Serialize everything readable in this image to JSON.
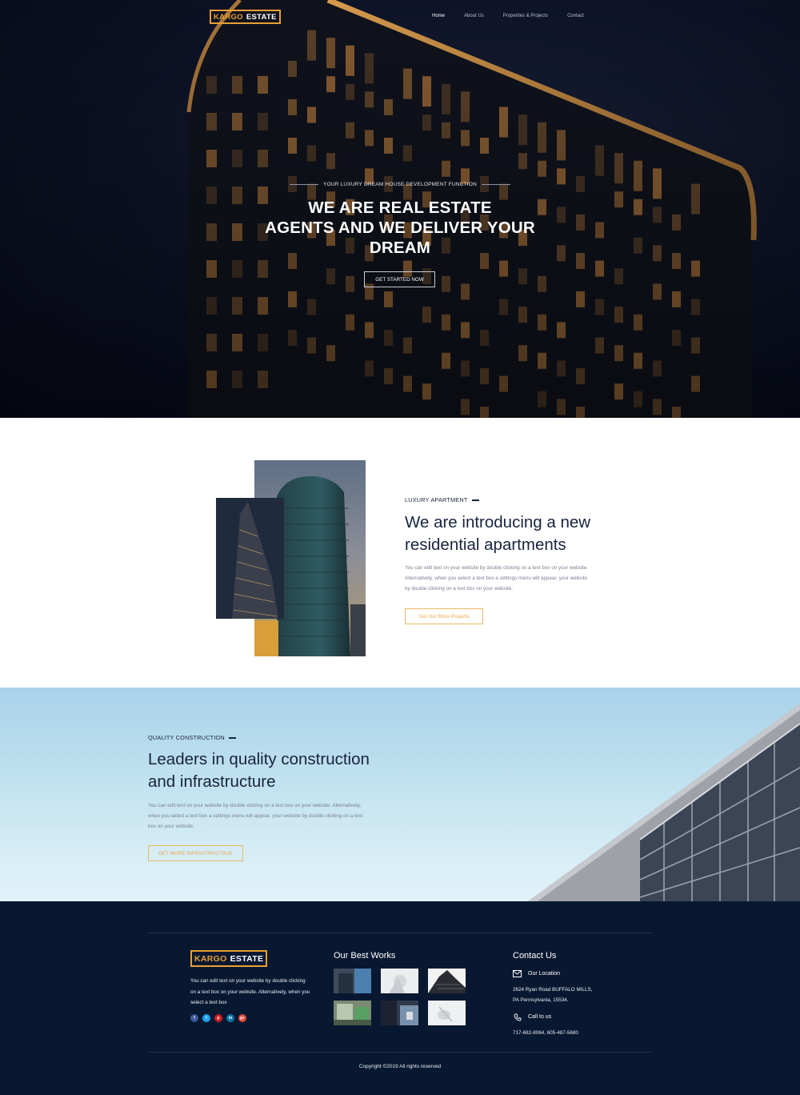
{
  "brand": {
    "name_part1": "KARGO",
    "name_part2": "ESTATE",
    "accent_color": "#e8a033"
  },
  "nav": {
    "items": [
      {
        "label": "Home",
        "active": true
      },
      {
        "label": "About Us",
        "active": false
      },
      {
        "label": "Properties & Projects",
        "active": false
      },
      {
        "label": "Contact",
        "active": false
      }
    ]
  },
  "hero": {
    "kicker": "YOUR LUXURY DREAM HOUSE DEVELOPMENT FUNCTION",
    "title_line1": "WE ARE REAL ESTATE",
    "title_line2": "AGENTS AND WE DELIVER YOUR",
    "title_line3": "DREAM",
    "cta_label": "GET STARTED NOW"
  },
  "apartment": {
    "kicker": "LUXURY APARTMENT",
    "title_line1": "We are introducing a new",
    "title_line2": "residential apartments",
    "body_line1": "You can edit text on your website by double clicking on a text box on your website.",
    "body_line2": "Alternatively, when you select a text box a settings menu will appear. your website",
    "body_line3": "by double clicking on a text box on your website.",
    "cta_label": "Get Our More Projects"
  },
  "construction": {
    "kicker": "QUALITY CONSTRUCTION",
    "title_line1": "Leaders in quality construction",
    "title_line2": "and infrastructure",
    "body_line1": "You can edit text on your website by double clicking on a text box on your website. Alternatively,",
    "body_line2": "when you select a text box a settings menu will appear. your website by double clicking on a text",
    "body_line3": "box on your website.",
    "cta_label": "GET MORE INFRASTRUCTRUE"
  },
  "footer": {
    "about_line1": "You can edit text on your website by double clicking",
    "about_line2": "on a text box on your website. Alternatively, when you",
    "about_line3": "select a text box",
    "socials": [
      {
        "icon": "facebook-icon",
        "glyph": "f",
        "color": "#3b5998"
      },
      {
        "icon": "twitter-icon",
        "glyph": "t",
        "color": "#1da1f2"
      },
      {
        "icon": "pinterest-icon",
        "glyph": "p",
        "color": "#cb2027"
      },
      {
        "icon": "linkedin-icon",
        "glyph": "in",
        "color": "#0e76a8"
      },
      {
        "icon": "google-plus-icon",
        "glyph": "g+",
        "color": "#dd4b39"
      }
    ],
    "works_heading": "Our Best Works",
    "contact_heading": "Contact Us",
    "location_label": "Our Location",
    "address_line1": "2624 Ryan Road BUFFALO MILLS,",
    "address_line2": "PA Pennsylvania, 15534.",
    "phone_label": "Call to us",
    "phone_numbers": "717-682-8064, 605-487-5680",
    "copyright": "Copyright ©2019 All rights reserved"
  }
}
